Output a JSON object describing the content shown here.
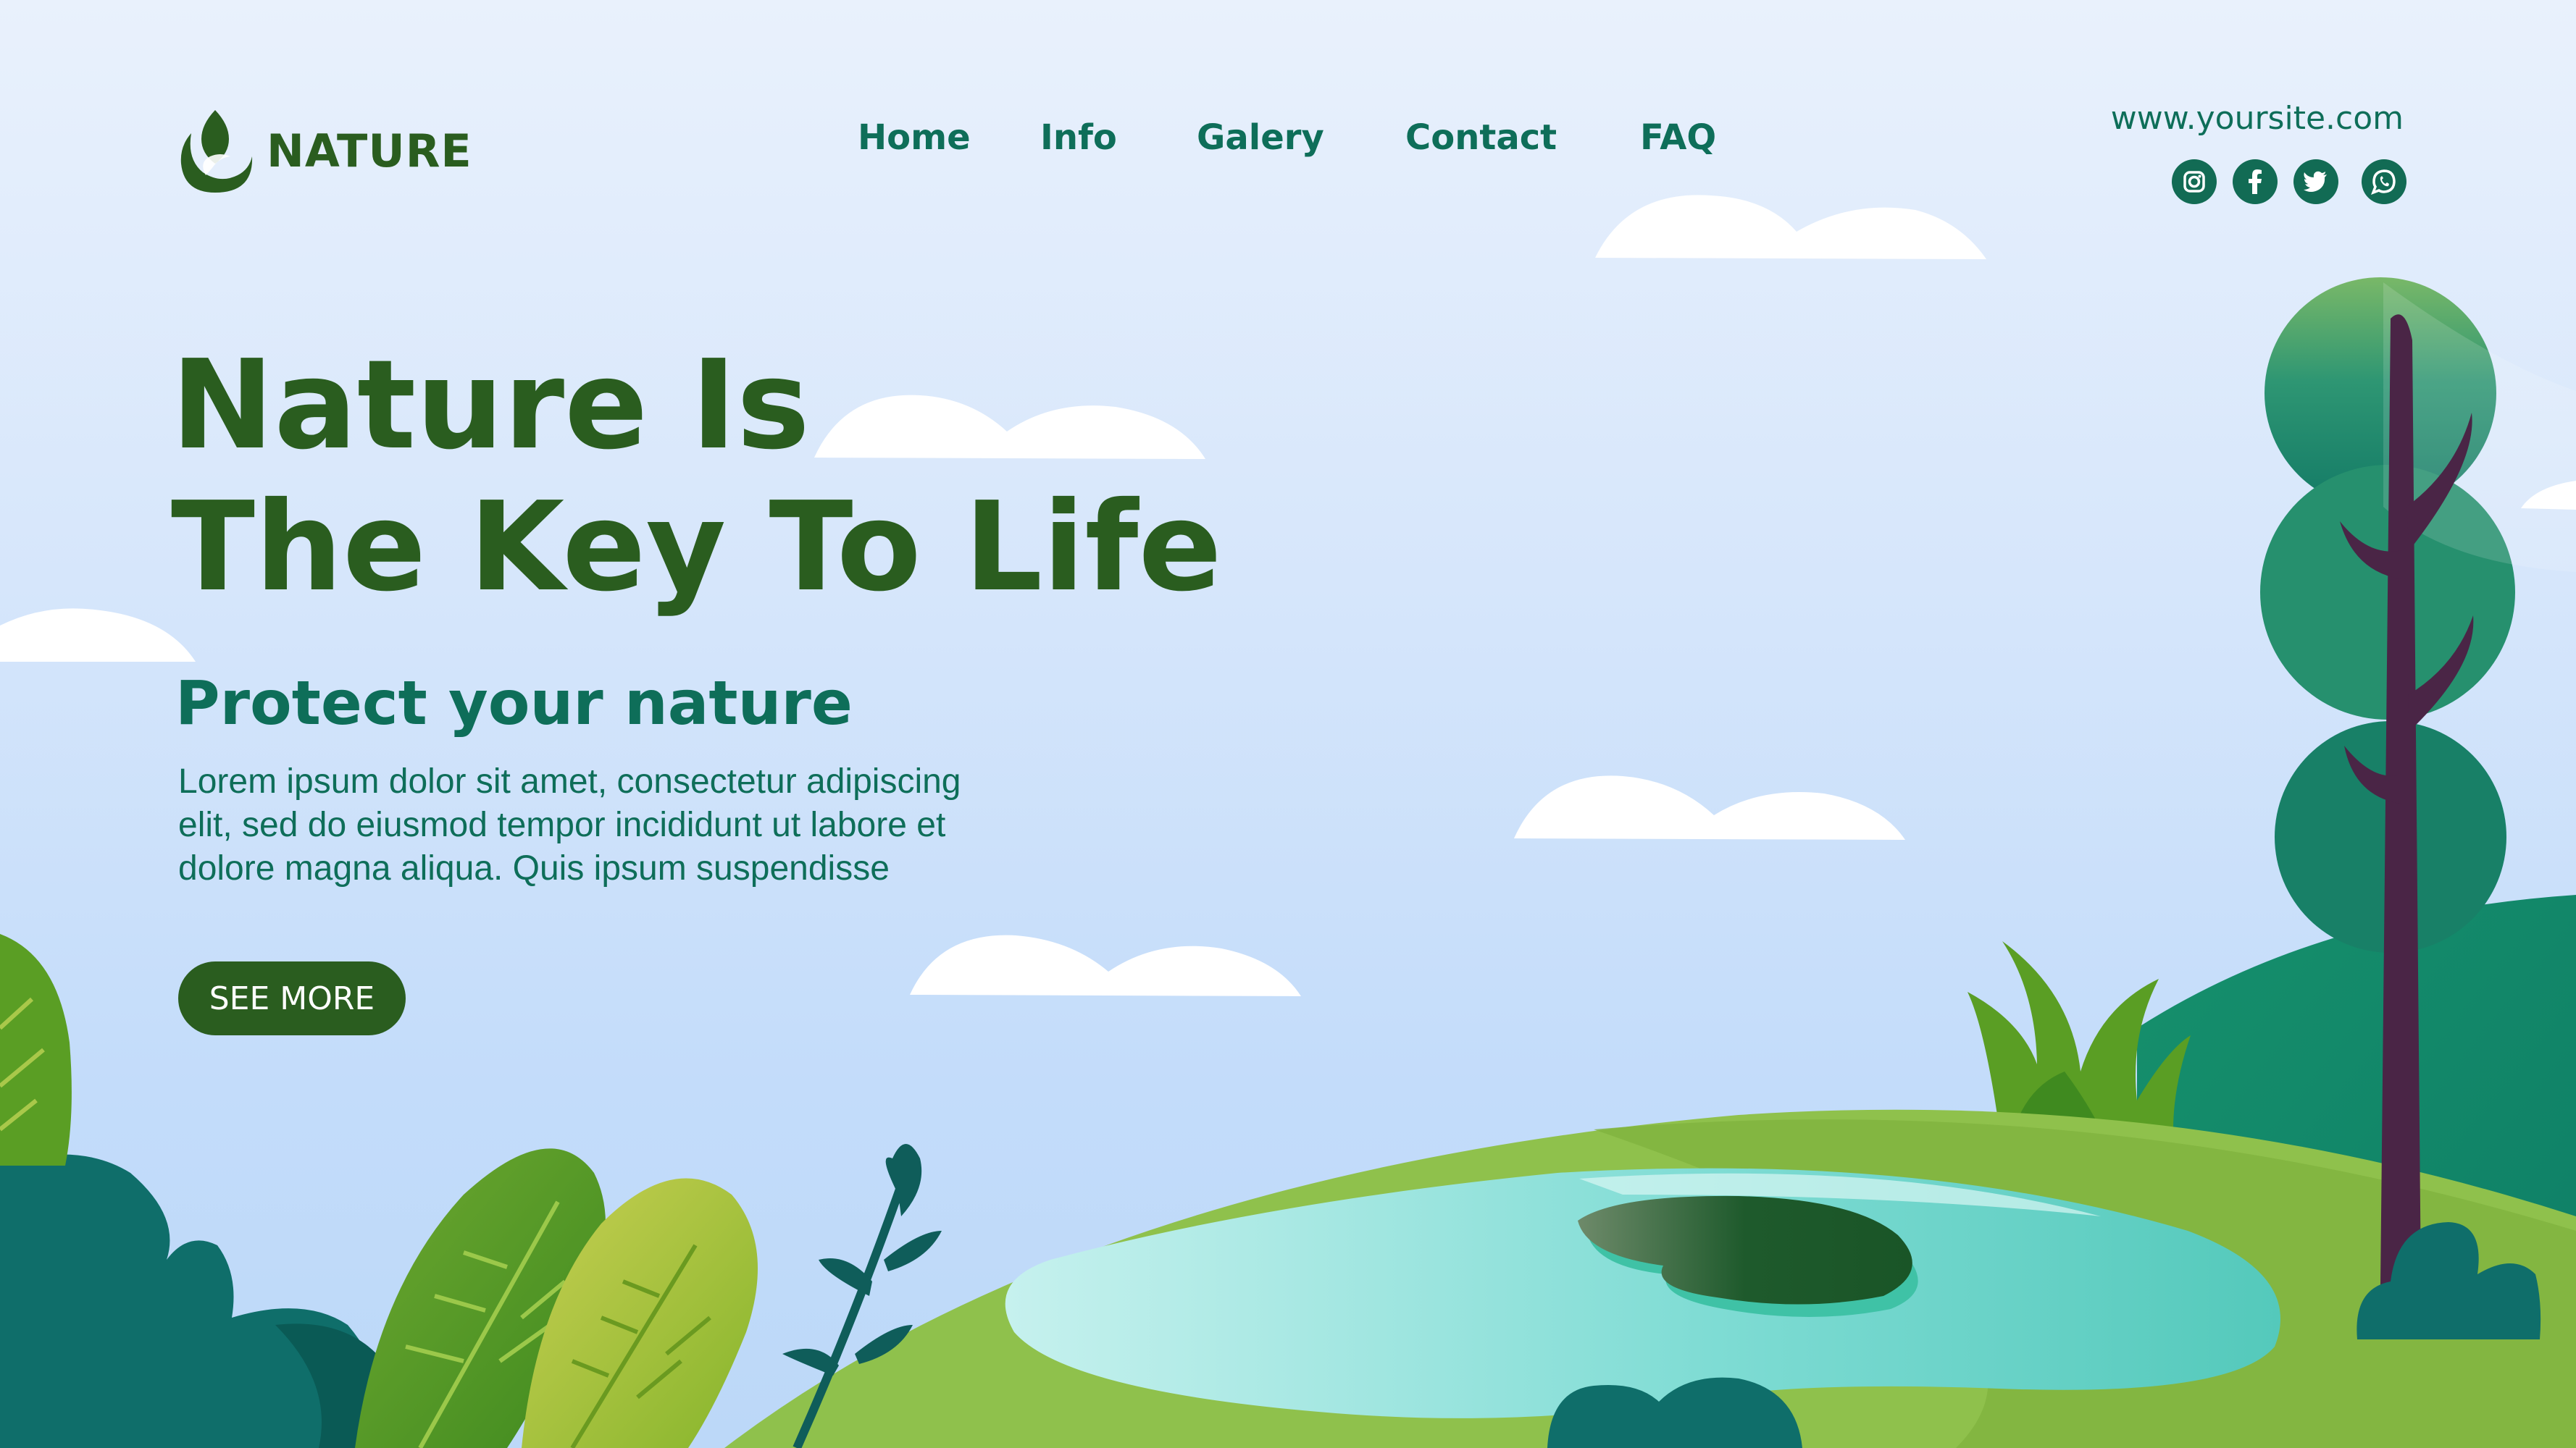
{
  "brand": {
    "name": "NATURE",
    "logo_icon": "leaf-flame-icon",
    "color_primary": "#2a5d1f",
    "color_secondary": "#0e6e59"
  },
  "nav": {
    "items": [
      {
        "label": "Home"
      },
      {
        "label": "Info"
      },
      {
        "label": "Galery"
      },
      {
        "label": "Contact"
      },
      {
        "label": "FAQ"
      }
    ]
  },
  "header": {
    "site_url": "www.yoursite.com",
    "social": [
      {
        "icon": "instagram-icon"
      },
      {
        "icon": "facebook-icon"
      },
      {
        "icon": "twitter-icon"
      },
      {
        "icon": "whatsapp-icon"
      }
    ]
  },
  "hero": {
    "title_line1": "Nature Is",
    "title_line2": "The Key To Life",
    "subtitle": "Protect your nature",
    "body_line1": "Lorem ipsum dolor sit amet, consectetur adipiscing",
    "body_line2": "elit, sed do eiusmod tempor incididunt ut labore et",
    "body_line3": "dolore magna aliqua. Quis ipsum suspendisse",
    "cta_label": "SEE MORE"
  },
  "illustration": {
    "sky_color": "#d6e6fb",
    "hill_color": "#8fc14c",
    "water_color": "#7fdcd4",
    "tree_trunk_color": "#4a2546",
    "cloud_color": "#ffffff"
  }
}
